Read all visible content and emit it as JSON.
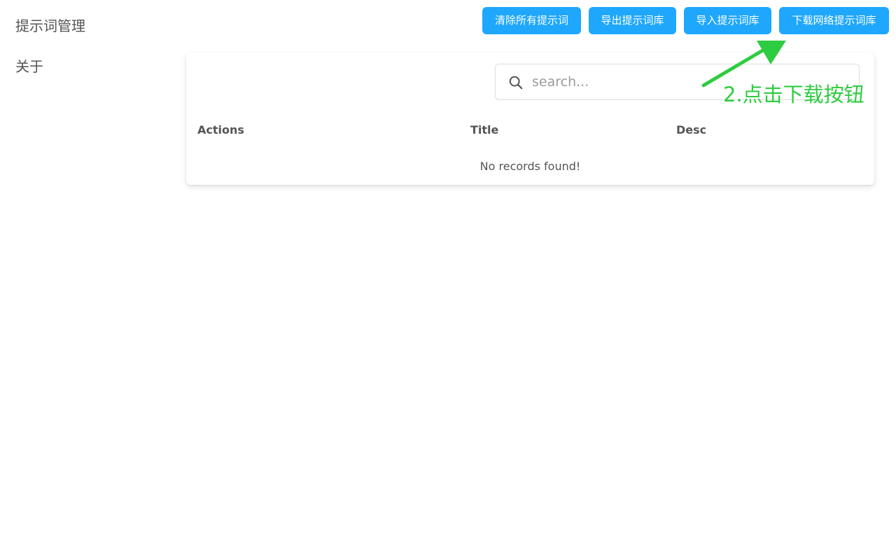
{
  "sidebar": {
    "items": [
      {
        "label": "提示词管理"
      },
      {
        "label": "关于"
      }
    ]
  },
  "toolbar": {
    "clear_all_label": "清除所有提示词",
    "export_label": "导出提示词库",
    "import_label": "导入提示词库",
    "download_label": "下载网络提示词库"
  },
  "search": {
    "placeholder": "search...",
    "value": ""
  },
  "table": {
    "columns": [
      "Actions",
      "Title",
      "Desc"
    ],
    "rows": [],
    "empty_message": "No records found!"
  },
  "annotation": {
    "text": "2.点击下载按钮",
    "color": "#2ecc40"
  },
  "colors": {
    "accent": "#1ea7fd",
    "annotation": "#2ecc40"
  },
  "icons": {
    "search": "search-icon",
    "annotation_arrow": "arrow-icon"
  }
}
